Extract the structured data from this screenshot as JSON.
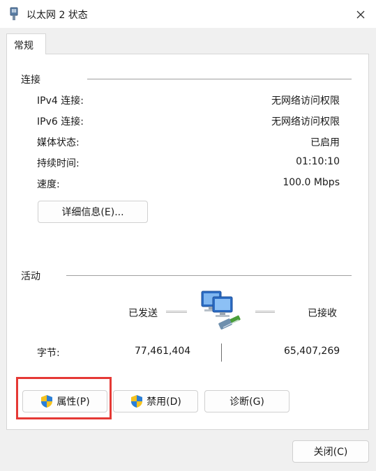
{
  "window": {
    "title": "以太网 2 状态",
    "close_icon": "close-icon"
  },
  "tabs": [
    {
      "label": "常规",
      "selected": true
    }
  ],
  "connection": {
    "section_label": "连接",
    "rows": [
      {
        "label": "IPv4 连接:",
        "value": "无网络访问权限"
      },
      {
        "label": "IPv6 连接:",
        "value": "无网络访问权限"
      },
      {
        "label": "媒体状态:",
        "value": "已启用"
      },
      {
        "label": "持续时间:",
        "value": "01:10:10"
      },
      {
        "label": "速度:",
        "value": "100.0 Mbps"
      }
    ],
    "details_button": "详细信息(E)..."
  },
  "activity": {
    "section_label": "活动",
    "sent_label": "已发送",
    "received_label": "已接收",
    "bytes_label": "字节:",
    "bytes_sent": "77,461,404",
    "bytes_received": "65,407,269",
    "network_icon": "network-computers-icon"
  },
  "buttons": {
    "properties": "属性(P)",
    "disable": "禁用(D)",
    "diagnose": "诊断(G)",
    "close": "关闭(C)"
  },
  "colors": {
    "highlight": "#e53935",
    "window_bg": "#f0f0f0",
    "panel_bg": "#ffffff"
  }
}
